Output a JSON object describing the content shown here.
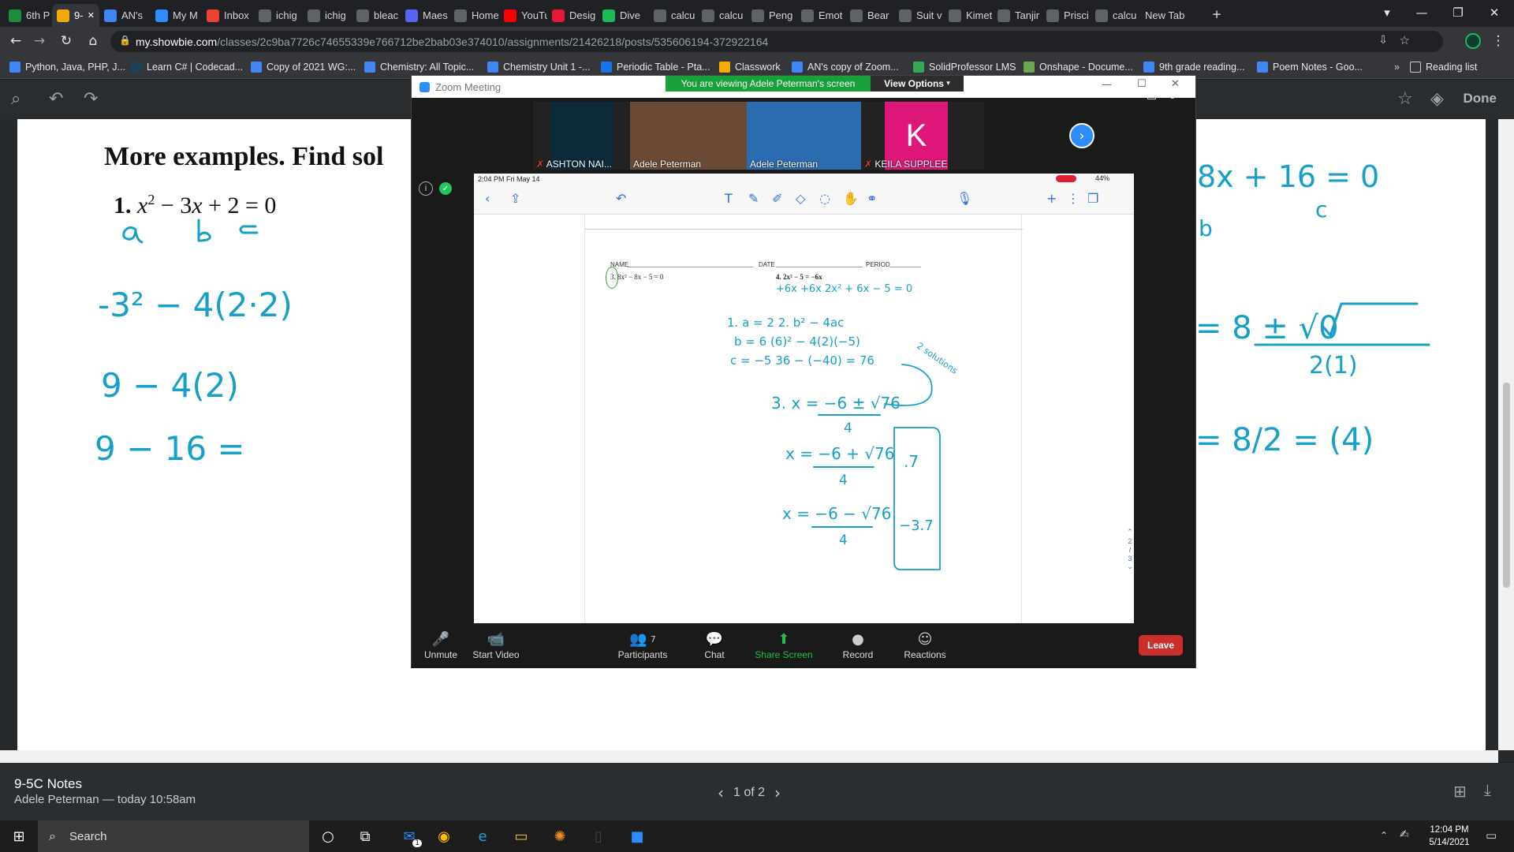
{
  "browser": {
    "tabs": [
      {
        "label": "6th P",
        "icon": "classroom-icon",
        "color": "#1e8e3e"
      },
      {
        "label": "9-",
        "icon": "showbie-icon",
        "color": "#f2a900",
        "active": true
      },
      {
        "label": "AN's",
        "icon": "docs-icon",
        "color": "#4285f4"
      },
      {
        "label": "My M",
        "icon": "zoom-icon",
        "color": "#2d8cff"
      },
      {
        "label": "Inbox",
        "icon": "gmail-icon",
        "color": "#ea4335"
      },
      {
        "label": "ichig",
        "icon": "google-icon",
        "color": "#5f6368"
      },
      {
        "label": "ichig",
        "icon": "google-icon",
        "color": "#5f6368"
      },
      {
        "label": "bleac",
        "icon": "google-icon",
        "color": "#5f6368"
      },
      {
        "label": "Maes",
        "icon": "discord-icon",
        "color": "#5865f2"
      },
      {
        "label": "Home",
        "icon": "page-icon",
        "color": "#5f6368"
      },
      {
        "label": "YouTu",
        "icon": "youtube-icon",
        "color": "#ff0000"
      },
      {
        "label": "Desig",
        "icon": "tesla-icon",
        "color": "#e31937"
      },
      {
        "label": "Dive",
        "icon": "dive-icon",
        "color": "#1db954"
      },
      {
        "label": "calcu",
        "icon": "google-icon",
        "color": "#5f6368"
      },
      {
        "label": "calcu",
        "icon": "google-icon",
        "color": "#5f6368"
      },
      {
        "label": "Peng",
        "icon": "page-icon",
        "color": "#5f6368"
      },
      {
        "label": "Emot",
        "icon": "page-icon",
        "color": "#5f6368"
      },
      {
        "label": "Bear",
        "icon": "page-icon",
        "color": "#5f6368"
      },
      {
        "label": "Suit v",
        "icon": "page-icon",
        "color": "#5f6368"
      },
      {
        "label": "Kimet",
        "icon": "page-icon",
        "color": "#5f6368"
      },
      {
        "label": "Tanjir",
        "icon": "page-icon",
        "color": "#5f6368"
      },
      {
        "label": "Prisci",
        "icon": "page-icon",
        "color": "#5f6368"
      },
      {
        "label": "calcu",
        "icon": "google-icon",
        "color": "#5f6368"
      },
      {
        "label": "New Tab",
        "icon": "",
        "color": ""
      }
    ],
    "url_domain": "my.showbie.com",
    "url_path": "/classes/2c9ba7726c74655339e766712be2bab03e374010/assignments/21426218/posts/535606194-372922164",
    "bookmarks": [
      {
        "label": "Python, Java, PHP, J...",
        "color": "#4285f4"
      },
      {
        "label": "Learn C# | Codecad...",
        "color": "#1f4056"
      },
      {
        "label": "Copy of 2021 WG:...",
        "color": "#4285f4"
      },
      {
        "label": "Chemistry: All Topic...",
        "color": "#4285f4"
      },
      {
        "label": "Chemistry Unit 1 -...",
        "color": "#4285f4"
      },
      {
        "label": "Periodic Table - Pta...",
        "color": "#1a73e8"
      },
      {
        "label": "Classwork",
        "color": "#f9ab00"
      },
      {
        "label": "AN's copy of Zoom...",
        "color": "#4285f4"
      },
      {
        "label": "SolidProfessor LMS",
        "color": "#34a853"
      },
      {
        "label": "Onshape - Docume...",
        "color": "#6aa84f"
      },
      {
        "label": "9th grade reading...",
        "color": "#4285f4"
      },
      {
        "label": "Poem Notes - Goo...",
        "color": "#4285f4"
      }
    ],
    "reading_list": "Reading list"
  },
  "showbie": {
    "done_label": "Done",
    "note_title": "9-5C Notes",
    "note_sub": "Adele Peterman — today 10:58am",
    "pager": "1 of 2"
  },
  "paper": {
    "heading": "More examples.  Find sol",
    "problem_num": "1.",
    "left_ink": [
      "a   b   c",
      "-3² − 4(2·2)",
      "9 − 4(2)",
      "9 − 16 ="
    ],
    "right_ink": [
      "8x + 16 = 0",
      "c",
      "b",
      "= 8 ± √0",
      "2(1)",
      "= 8/2 = (4)"
    ]
  },
  "zoom": {
    "window_title": "Zoom Meeting",
    "banner": "You are viewing Adele Peterman's screen",
    "view_options": "View Options",
    "participants_tiles": [
      {
        "name": "ASHTON NAI...",
        "muted": true,
        "bg": "#0d2a3a"
      },
      {
        "name": "Adele Peterman",
        "muted": false,
        "bg": "#6a4a34"
      },
      {
        "name": "Adele Peterman",
        "muted": false,
        "bg": "#2b6cb0"
      },
      {
        "name": "KEILA SUPPLEE",
        "muted": true,
        "bg": "#e0177a",
        "initial": "K"
      }
    ],
    "ipad_status_time": "2:04 PM   Fri May 14",
    "ipad_battery": "44%",
    "worksheet": {
      "name_label": "NAME",
      "date_label": "DATE",
      "period_label": "PERIOD",
      "prob3": "3.  8x² − 8x − 5 = 0",
      "prob4": "4. 2x² − 5 = −6x",
      "steps": [
        "+6x  +6x     2x² + 6x − 5 = 0",
        "1.  a = 2      2. b² − 4ac",
        "b = 6         (6)² − 4(2)(−5)",
        "c = −5          36 − (−40) = 76",
        "3. x = −6 ± √76",
        "4",
        "x = −6 + √76",
        "x = −6 − √76",
        ".7",
        "−3.7",
        "2 solutions"
      ],
      "page_indicator": [
        "2",
        "/",
        "3"
      ]
    },
    "controls": [
      {
        "label": "Unmute",
        "icon": "mic-muted-icon"
      },
      {
        "label": "Start Video",
        "icon": "video-off-icon"
      },
      {
        "label": "Participants",
        "icon": "participants-icon",
        "count": "7"
      },
      {
        "label": "Chat",
        "icon": "chat-icon"
      },
      {
        "label": "Share Screen",
        "icon": "share-screen-icon"
      },
      {
        "label": "Record",
        "icon": "record-icon"
      },
      {
        "label": "Reactions",
        "icon": "reactions-icon"
      }
    ],
    "leave": "Leave"
  },
  "taskbar": {
    "search_placeholder": "Search",
    "time": "12:04 PM",
    "date": "5/14/2021",
    "mail_badge": "1"
  }
}
